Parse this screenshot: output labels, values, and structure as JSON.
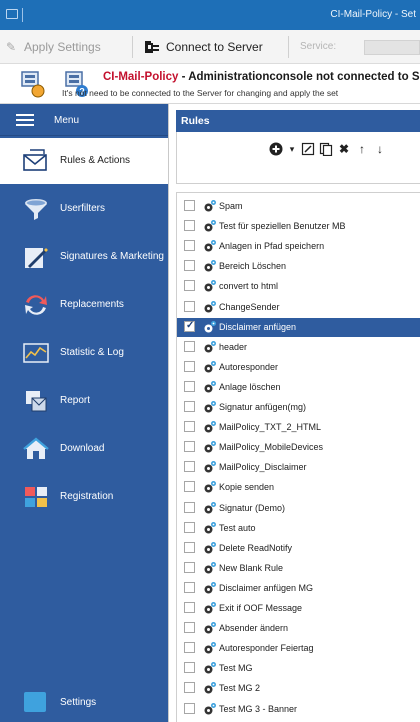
{
  "titlebar": {
    "title": "CI-Mail-Policy - Set"
  },
  "toolbar": {
    "apply_label": "Apply Settings",
    "connect_label": "Connect to Server",
    "service_label": "Service:"
  },
  "status": {
    "title_prefix": "CI-Mail-Policy",
    "title_rest": " - Administrationconsole not connected to Se",
    "subtitle": "It's not need to be connected to the Server for changing and apply the set"
  },
  "sidebar": {
    "menu_label": "Menu",
    "items": [
      {
        "label": "Rules & Actions",
        "icon": "envelope-icon"
      },
      {
        "label": "Userfilters",
        "icon": "funnel-icon"
      },
      {
        "label": "Signatures & Marketing",
        "icon": "signature-icon"
      },
      {
        "label": "Replacements",
        "icon": "replace-icon"
      },
      {
        "label": "Statistic & Log",
        "icon": "chart-icon"
      },
      {
        "label": "Report",
        "icon": "report-icon"
      },
      {
        "label": "Download",
        "icon": "home-icon"
      },
      {
        "label": "Registration",
        "icon": "registration-icon"
      }
    ],
    "settings_label": "Settings"
  },
  "rules": {
    "header": "Rules",
    "items": [
      {
        "label": "Spam",
        "checked": false
      },
      {
        "label": "Test für speziellen Benutzer MB",
        "checked": false
      },
      {
        "label": "Anlagen in Pfad speichern",
        "checked": false
      },
      {
        "label": "Bereich Löschen",
        "checked": false
      },
      {
        "label": "convert to html",
        "checked": false
      },
      {
        "label": "ChangeSender",
        "checked": false
      },
      {
        "label": "Disclaimer anfügen",
        "checked": true
      },
      {
        "label": "header",
        "checked": false
      },
      {
        "label": "Autoresponder",
        "checked": false
      },
      {
        "label": "Anlage löschen",
        "checked": false
      },
      {
        "label": "Signatur anfügen(mg)",
        "checked": false
      },
      {
        "label": "MailPolicy_TXT_2_HTML",
        "checked": false
      },
      {
        "label": "MailPolicy_MobileDevices",
        "checked": false
      },
      {
        "label": "MailPolicy_Disclaimer",
        "checked": false
      },
      {
        "label": "Kopie senden",
        "checked": false
      },
      {
        "label": "Signatur (Demo)",
        "checked": false
      },
      {
        "label": "Test auto",
        "checked": false
      },
      {
        "label": "Delete ReadNotify",
        "checked": false
      },
      {
        "label": "New Blank Rule",
        "checked": false
      },
      {
        "label": "Disclaimer anfügen MG",
        "checked": false
      },
      {
        "label": "Exit if OOF Message",
        "checked": false
      },
      {
        "label": "Absender ändern",
        "checked": false
      },
      {
        "label": "Autoresponder Feiertag",
        "checked": false
      },
      {
        "label": "Test MG",
        "checked": false
      },
      {
        "label": "Test MG 2",
        "checked": false
      },
      {
        "label": "Test MG 3 - Banner",
        "checked": false
      }
    ]
  },
  "colors": {
    "accent": "#2f5c9f",
    "titlebar": "#1e6fb7",
    "status_red": "#c3102d"
  }
}
